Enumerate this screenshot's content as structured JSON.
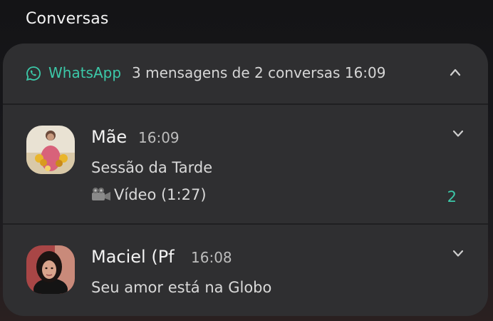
{
  "section": {
    "title": "Conversas"
  },
  "notification": {
    "app_name": "WhatsApp",
    "summary": "3 mensagens de 2 conversas",
    "time": "16:09",
    "accent_color": "#3cc8a8",
    "icon": "whatsapp-icon",
    "collapse_icon": "chevron-up-icon"
  },
  "messages": [
    {
      "sender": "Mãe",
      "time": "16:09",
      "line1": "Sessão da Tarde",
      "line2": "Vídeo (1:27)",
      "line2_icon": "video-camera-icon",
      "count": "2",
      "expand_icon": "chevron-down-icon"
    },
    {
      "sender": "Maciel (Pf",
      "time": "16:08",
      "line1": "Seu amor está na Globo",
      "expand_icon": "chevron-down-icon"
    }
  ]
}
